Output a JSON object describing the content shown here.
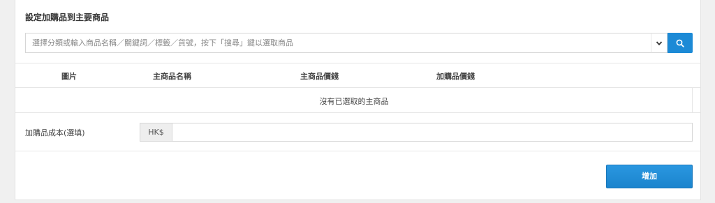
{
  "section": {
    "title": "設定加購品到主要商品"
  },
  "search": {
    "placeholder": "選擇分類或輸入商品名稱／關鍵詞／標籤／貨號，按下「搜尋」鍵以選取商品",
    "dropdown_icon": "chevron-down-icon",
    "search_icon": "search-icon",
    "accent_color": "#1c8ad6"
  },
  "table": {
    "columns": [
      "圖片",
      "主商品名稱",
      "主商品價錢",
      "加購品價錢"
    ],
    "empty_message": "沒有已選取的主商品"
  },
  "cost": {
    "label": "加購品成本(選填)",
    "currency": "HK$",
    "value": ""
  },
  "actions": {
    "add_label": "增加"
  }
}
